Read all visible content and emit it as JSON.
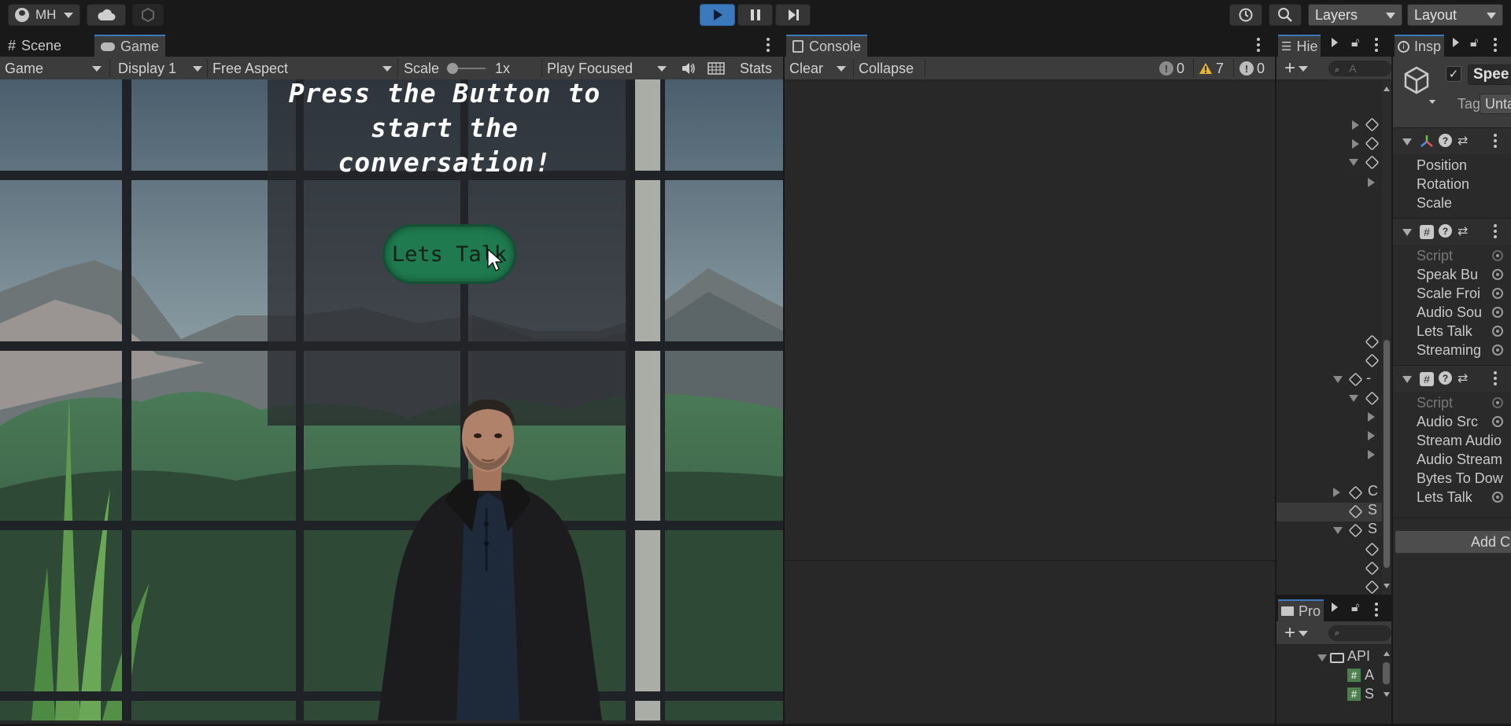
{
  "toolbar": {
    "account_label": "MH",
    "layers_label": "Layers",
    "layout_label": "Layout"
  },
  "game_panel": {
    "tab_scene": "Scene",
    "tab_game": "Game",
    "view_mode": "Game",
    "display": "Display 1",
    "aspect": "Free Aspect",
    "scale_label": "Scale",
    "scale_value": "1x",
    "play_mode": "Play Focused",
    "stats_label": "Stats",
    "scene_text": {
      "heading": "Press the Button to start the conversation!",
      "button_label": "Lets Talk"
    }
  },
  "console_panel": {
    "tab_label": "Console",
    "clear_label": "Clear",
    "collapse_label": "Collapse",
    "log_count": "0",
    "warning_count": "7",
    "error_count": "0"
  },
  "hierarchy_panel": {
    "tab_label": "Hie",
    "search_placeholder": "A",
    "row_labels": [
      "-",
      "C",
      "S",
      "S"
    ]
  },
  "project_panel": {
    "tab_label": "Pro",
    "folder_label": "API",
    "files": [
      "A",
      "S"
    ]
  },
  "inspector_panel": {
    "tab_label": "Insp",
    "object_name": "Spee",
    "tag_label": "Tag",
    "tag_value": "Unta",
    "transform_fields": [
      "Position",
      "Rotation",
      "Scale"
    ],
    "component1_fields": [
      "Script",
      "Speak Bu",
      "Scale Froi",
      "Audio Sou",
      "Lets Talk",
      "Streaming"
    ],
    "component2_fields": [
      "Script",
      "Audio Src",
      "Stream Audio",
      "Audio Stream",
      "Bytes To Dow",
      "Lets Talk"
    ],
    "add_component_label": "Add C"
  },
  "colors": {
    "accent_blue": "#3a79bb",
    "lets_talk_green": "#1f7a4f",
    "warning_yellow": "#e8b52b"
  }
}
